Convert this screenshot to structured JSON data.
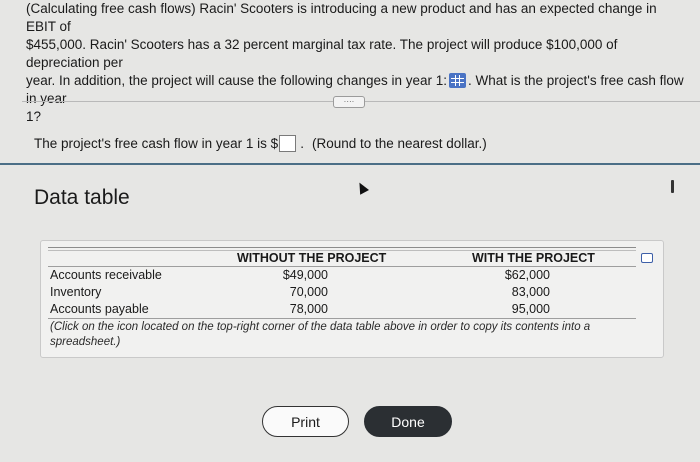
{
  "question": {
    "line1": "(Calculating free cash flows) Racin' Scooters is introducing a new product and has an expected change in EBIT of",
    "line2": "$455,000. Racin' Scooters has a 32 percent marginal tax rate. The project will produce $100,000 of depreciation per",
    "line3a": "year. In addition, the project will cause the following changes in year 1:",
    "line3b": ". What is the project's free cash flow in year",
    "line4": "1?"
  },
  "expand_label": "····",
  "answer": {
    "prefix": "The project's free cash flow in year 1 is $",
    "value": "",
    "hint": "(Round to the nearest dollar.)"
  },
  "modal": {
    "title": "Data table",
    "columns": [
      "WITHOUT THE PROJECT",
      "WITH THE PROJECT"
    ],
    "rows": [
      {
        "label": "Accounts receivable",
        "without": "$49,000",
        "with": "$62,000"
      },
      {
        "label": "Inventory",
        "without": "70,000",
        "with": "83,000"
      },
      {
        "label": "Accounts payable",
        "without": "78,000",
        "with": "95,000"
      }
    ],
    "note": "(Click on the icon located on the top-right corner of the data table above in order to copy its contents into a spreadsheet.)",
    "print_label": "Print",
    "done_label": "Done"
  },
  "icons": {
    "data_table": "table-grid-icon",
    "copy": "copy-icon"
  },
  "colors": {
    "accent_blue": "#4a73c4",
    "done_button_bg": "#2b2f33",
    "modal_divider": "#4b6e86"
  }
}
